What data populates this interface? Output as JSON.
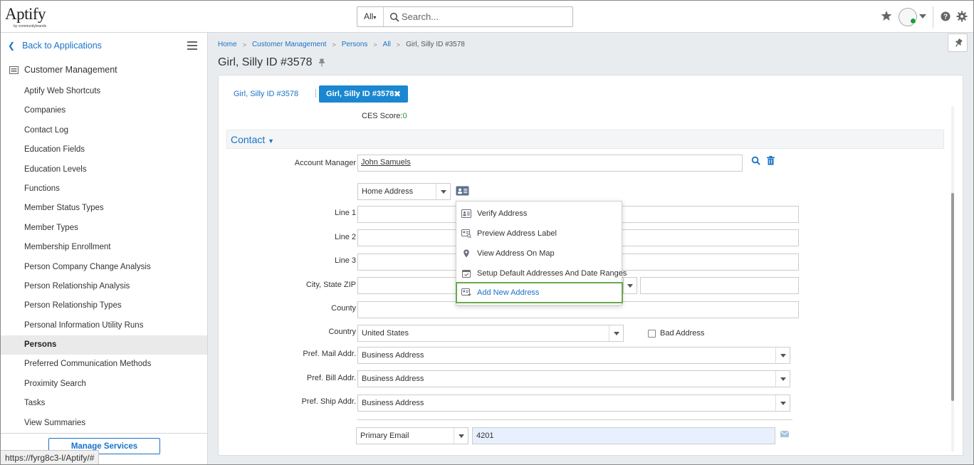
{
  "app": {
    "logo_text": "Aptify",
    "logo_sub": "by communitybrands",
    "search_scope": "All",
    "search_placeholder": "Search..."
  },
  "sidebar": {
    "back_label": "Back to Applications",
    "module_title": "Customer Management",
    "items": [
      {
        "label": "Aptify Web Shortcuts"
      },
      {
        "label": "Companies"
      },
      {
        "label": "Contact Log"
      },
      {
        "label": "Education Fields"
      },
      {
        "label": "Education Levels"
      },
      {
        "label": "Functions"
      },
      {
        "label": "Member Status Types"
      },
      {
        "label": "Member Types"
      },
      {
        "label": "Membership Enrollment"
      },
      {
        "label": "Person Company Change Analysis"
      },
      {
        "label": "Person Relationship Analysis"
      },
      {
        "label": "Person Relationship Types"
      },
      {
        "label": "Personal Information Utility Runs"
      },
      {
        "label": "Persons",
        "active": true
      },
      {
        "label": "Preferred Communication Methods"
      },
      {
        "label": "Proximity Search"
      },
      {
        "label": "Tasks"
      },
      {
        "label": "View Summaries"
      }
    ],
    "manage_services_label": "Manage Services"
  },
  "status_url": "https://fyrg8c3-l/Aptify/#",
  "breadcrumb": {
    "items": [
      "Home",
      "Customer Management",
      "Persons",
      "All"
    ],
    "current": "Girl, Silly ID #3578"
  },
  "page": {
    "title": "Girl, Silly ID #3578"
  },
  "tabs": {
    "tab1_label": "Girl, Silly ID #3578",
    "tab2_label": "Girl, Silly ID #3578"
  },
  "ces": {
    "label": "CES Score:",
    "value": "0"
  },
  "contact": {
    "section_title": "Contact",
    "account_manager_label": "Account Manager",
    "account_manager_value": "John Samuels",
    "address_type": "Home Address",
    "line1_label": "Line 1",
    "line2_label": "Line 2",
    "line3_label": "Line 3",
    "city_label": "City, State ZIP",
    "county_label": "County",
    "country_label": "Country",
    "country_value": "United States",
    "bad_address_label": "Bad Address",
    "pref_mail_label": "Pref. Mail Addr.",
    "pref_mail_value": "Business Address",
    "pref_bill_label": "Pref. Bill Addr.",
    "pref_bill_value": "Business Address",
    "pref_ship_label": "Pref. Ship Addr.",
    "pref_ship_value": "Business Address",
    "email_type": "Primary Email",
    "email_value": "4201"
  },
  "address_menu": {
    "items": [
      {
        "label": "Verify Address",
        "icon": "address-card-icon"
      },
      {
        "label": "Preview Address Label",
        "icon": "label-preview-icon"
      },
      {
        "label": "View Address On Map",
        "icon": "map-pin-icon"
      },
      {
        "label": "Setup Default Addresses And Date Ranges",
        "icon": "calendar-check-icon"
      },
      {
        "label": "Add New Address",
        "icon": "add-address-icon",
        "highlighted": true
      }
    ]
  },
  "colors": {
    "accent": "#1a73c6",
    "tab_active": "#1a87d0",
    "highlight_border": "#6aa84f",
    "online_status": "#1e9e3e"
  }
}
